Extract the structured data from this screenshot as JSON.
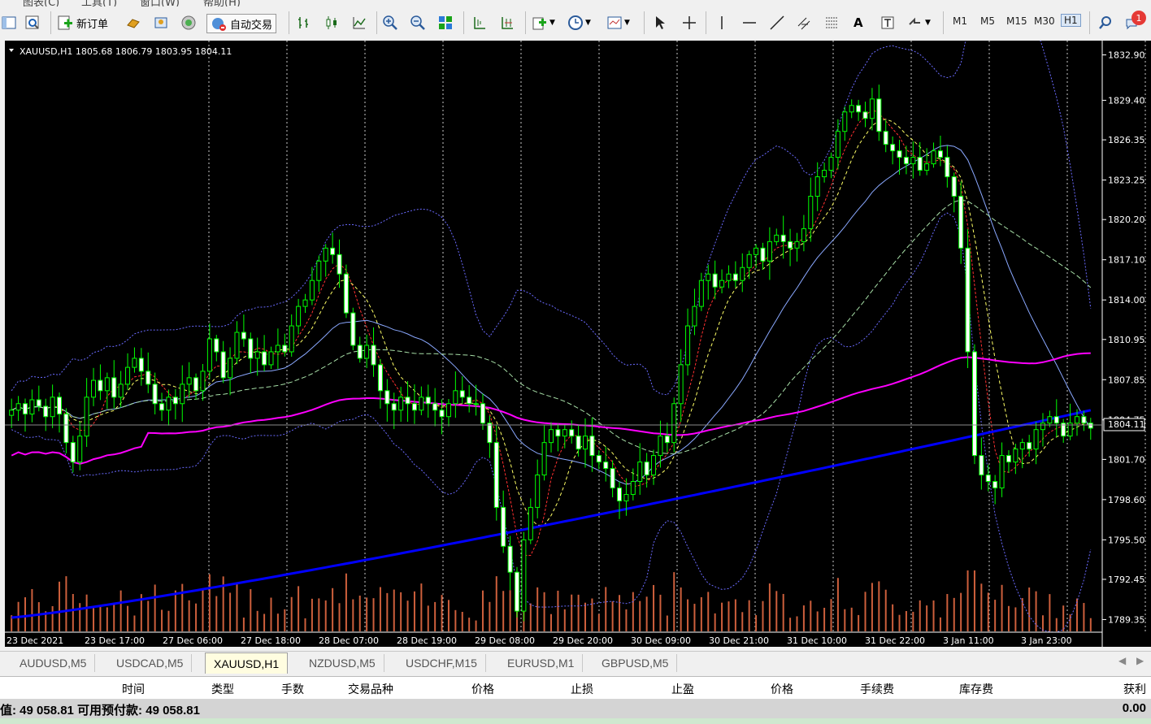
{
  "menu": [
    "图表(C)",
    "工具(T)",
    "窗口(W)",
    "帮助(H)"
  ],
  "toolbar": {
    "new_order": "新订单",
    "auto_trade": "自动交易",
    "timeframes": [
      "M1",
      "M5",
      "M15",
      "M30",
      "H1"
    ],
    "active_timeframe": "H1",
    "notification_count": "1"
  },
  "chart": {
    "header": "XAUUSD,H1  1805.68 1806.79 1803.95 1804.11",
    "current_price_label": "1804.11",
    "colors": {
      "background": "#000000",
      "bull_candle": "#00ff00",
      "bear_candle": "#ffffff",
      "ma_slow": "#0000ff",
      "ma_mid": "#ff00ff",
      "bollinger": "#6a6aff",
      "volume": "#cd5f3c"
    }
  },
  "chart_data": {
    "type": "candlestick",
    "symbol": "XAUUSD",
    "timeframe": "H1",
    "ylim": [
      1788.5,
      1833.5
    ],
    "y_ticks": [
      "1832.90",
      "1829.40",
      "1826.35",
      "1823.25",
      "1820.20",
      "1817.10",
      "1814.00",
      "1810.95",
      "1807.85",
      "1804.75",
      "1801.70",
      "1798.60",
      "1795.50",
      "1792.45",
      "1789.35"
    ],
    "x_ticks": [
      "23 Dec 2021",
      "23 Dec 17:00",
      "27 Dec 06:00",
      "27 Dec 18:00",
      "28 Dec 07:00",
      "28 Dec 19:00",
      "29 Dec 08:00",
      "29 Dec 20:00",
      "30 Dec 09:00",
      "30 Dec 21:00",
      "31 Dec 10:00",
      "31 Dec 22:00",
      "3 Jan 11:00",
      "3 Jan 23:00"
    ],
    "last": {
      "open": 1805.68,
      "high": 1806.79,
      "low": 1803.95,
      "close": 1804.11
    },
    "close_path": [
      1805.5,
      1806.0,
      1805.2,
      1806.3,
      1805.8,
      1805.0,
      1806.5,
      1805.2,
      1803.0,
      1801.5,
      1803.5,
      1806.5,
      1807.8,
      1807.0,
      1808.0,
      1806.5,
      1807.5,
      1808.8,
      1809.5,
      1808.5,
      1807.5,
      1806.0,
      1805.5,
      1806.5,
      1806.0,
      1807.5,
      1808.0,
      1807.0,
      1808.5,
      1811.0,
      1810.0,
      1808.0,
      1809.5,
      1811.5,
      1811.0,
      1809.5,
      1810.0,
      1809.0,
      1810.0,
      1810.5,
      1810.0,
      1812.0,
      1813.5,
      1814.0,
      1815.5,
      1817.0,
      1818.0,
      1817.5,
      1816.0,
      1813.0,
      1810.5,
      1809.5,
      1810.5,
      1809.0,
      1807.0,
      1806.0,
      1805.5,
      1806.5,
      1806.0,
      1805.5,
      1806.5,
      1806.0,
      1805.5,
      1805.0,
      1806.0,
      1807.0,
      1806.5,
      1806.0,
      1806.0,
      1804.5,
      1803.0,
      1798.0,
      1795.0,
      1793.0,
      1790.0,
      1795.5,
      1798.0,
      1800.5,
      1803.0,
      1804.0,
      1803.5,
      1804.0,
      1803.5,
      1802.5,
      1803.5,
      1802.0,
      1801.5,
      1801.0,
      1799.5,
      1798.5,
      1799.0,
      1800.0,
      1801.5,
      1800.5,
      1802.0,
      1803.5,
      1803.0,
      1806.0,
      1809.0,
      1812.0,
      1813.5,
      1815.5,
      1816.0,
      1815.0,
      1815.5,
      1816.0,
      1815.5,
      1816.5,
      1817.5,
      1818.0,
      1817.0,
      1818.5,
      1819.0,
      1818.5,
      1818.0,
      1818.5,
      1819.5,
      1822.0,
      1823.5,
      1824.0,
      1825.0,
      1827.0,
      1828.5,
      1829.0,
      1828.5,
      1828.0,
      1829.5,
      1827.0,
      1826.0,
      1825.5,
      1825.0,
      1824.5,
      1825.0,
      1824.0,
      1824.5,
      1825.5,
      1825.0,
      1823.5,
      1822.0,
      1818.0,
      1810.0,
      1802.0,
      1800.5,
      1800.0,
      1799.5,
      1802.0,
      1801.5,
      1802.5,
      1803.0,
      1802.5,
      1804.0,
      1804.5,
      1805.0,
      1804.5,
      1803.5,
      1804.5,
      1805.0,
      1804.5,
      1804.11
    ]
  },
  "tabs": [
    "AUDUSD,M5",
    "USDCAD,M5",
    "XAUUSD,H1",
    "NZDUSD,M5",
    "USDCHF,M15",
    "EURUSD,M1",
    "GBPUSD,M5"
  ],
  "active_tab": "XAUUSD,H1",
  "terminal": {
    "columns": [
      "时间",
      "类型",
      "手数",
      "交易品种",
      "价格",
      "止损",
      "止盈",
      "价格",
      "手续费",
      "库存费",
      "获利"
    ],
    "balance_text": "值: 49 058.81  可用预付款: 49 058.81",
    "profit": "0.00"
  }
}
